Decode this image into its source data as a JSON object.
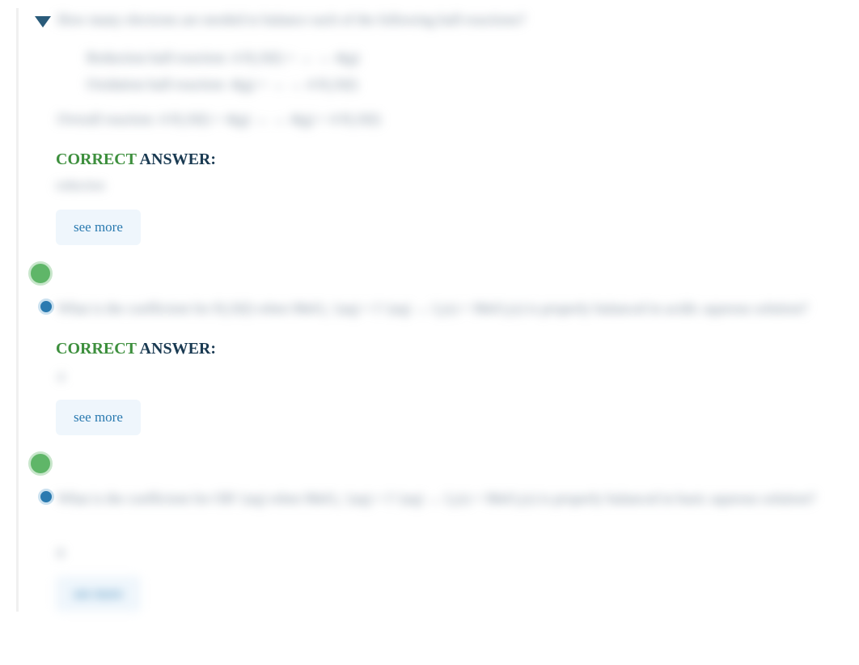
{
  "question1": {
    "promptBlur": "How many electrons are needed to balance each of the following half-reactions?",
    "halfReaction1Blur": "Reduction half-reaction: 4 H₂O(l) + → → 4(g)",
    "halfReaction2Blur": "Oxidation half-reaction: 4(g) + → → 4 H₂O(l)",
    "overallBlur": "Overall reaction:       4 H₂O(l) + 4(g) → → 4(g) + 4 H₂O(l)",
    "correctLabel": "CORRECT",
    "answerLabel": " ANSWER:",
    "answerBlur": "reduction",
    "seeMore": "see more"
  },
  "question2": {
    "promptBlur": "What is the coefficient for H₂O(l) when MnO₄⁻(aq) + I⁻(aq) → I₂(s) + MnO₂(s) is properly balanced in acidic aqueous solution?",
    "correctLabel": "CORRECT",
    "answerLabel": " ANSWER:",
    "answerBlur": "4",
    "seeMore": "see more"
  },
  "question3": {
    "promptBlur": "What is the coefficient for OH⁻(aq) when MnO₄⁻(aq) + I⁻(aq) → I₂(s) + MnO₂(s) is properly balanced in basic aqueous solution?",
    "answerBlur": "8",
    "seeMoreBlur": "see more"
  }
}
